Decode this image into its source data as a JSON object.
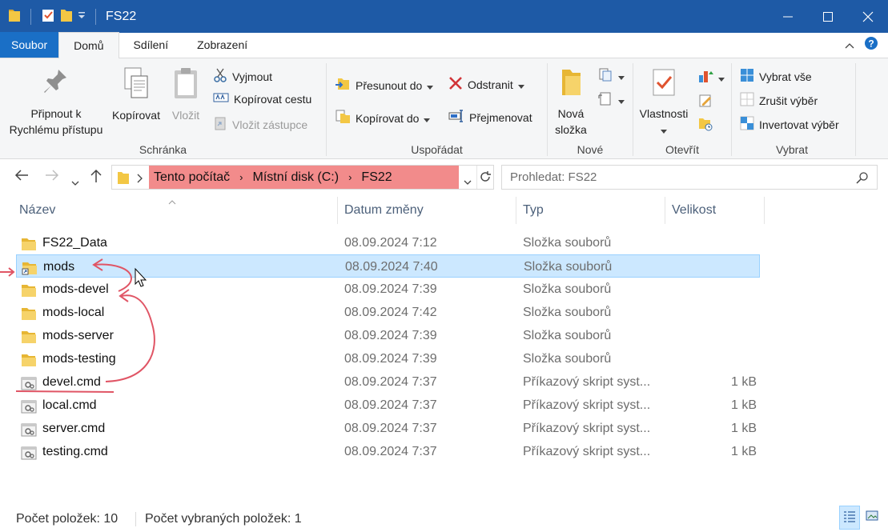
{
  "window": {
    "title": "FS22",
    "controls": [
      "minimize",
      "maximize",
      "close"
    ]
  },
  "tabs": [
    {
      "label": "Soubor"
    },
    {
      "label": "Domů"
    },
    {
      "label": "Sdílení"
    },
    {
      "label": "Zobrazení"
    }
  ],
  "ribbon": {
    "clipboard": {
      "label": "Schránka",
      "pin_line1": "Připnout k",
      "pin_line2": "Rychlému přístupu",
      "copy": "Kopírovat",
      "paste": "Vložit",
      "cut": "Vyjmout",
      "copy_path": "Kopírovat cestu",
      "paste_shortcut": "Vložit zástupce"
    },
    "organize": {
      "label": "Uspořádat",
      "move_to": "Přesunout do",
      "copy_to": "Kopírovat do",
      "delete": "Odstranit",
      "rename": "Přejmenovat"
    },
    "new": {
      "label": "Nové",
      "new_folder_line1": "Nová",
      "new_folder_line2": "složka"
    },
    "open": {
      "label": "Otevřít",
      "properties": "Vlastnosti"
    },
    "select": {
      "label": "Vybrat",
      "select_all": "Vybrat vše",
      "select_none": "Zrušit výběr",
      "invert": "Invertovat výběr"
    }
  },
  "address": {
    "crumbs": [
      "Tento počítač",
      "Místní disk (C:)",
      "FS22"
    ],
    "search_placeholder": "Prohledat: FS22"
  },
  "columns": {
    "name": "Název",
    "date": "Datum změny",
    "type": "Typ",
    "size": "Velikost"
  },
  "files": [
    {
      "name": "FS22_Data",
      "date": "08.09.2024 7:12",
      "type": "Složka souborů",
      "size": "",
      "kind": "folder"
    },
    {
      "name": "mods",
      "date": "08.09.2024 7:40",
      "type": "Složka souborů",
      "size": "",
      "kind": "folder-link",
      "selected": true
    },
    {
      "name": "mods-devel",
      "date": "08.09.2024 7:39",
      "type": "Složka souborů",
      "size": "",
      "kind": "folder"
    },
    {
      "name": "mods-local",
      "date": "08.09.2024 7:42",
      "type": "Složka souborů",
      "size": "",
      "kind": "folder"
    },
    {
      "name": "mods-server",
      "date": "08.09.2024 7:39",
      "type": "Složka souborů",
      "size": "",
      "kind": "folder"
    },
    {
      "name": "mods-testing",
      "date": "08.09.2024 7:39",
      "type": "Složka souborů",
      "size": "",
      "kind": "folder"
    },
    {
      "name": "devel.cmd",
      "date": "08.09.2024 7:37",
      "type": "Příkazový skript syst...",
      "size": "1 kB",
      "kind": "cmd"
    },
    {
      "name": "local.cmd",
      "date": "08.09.2024 7:37",
      "type": "Příkazový skript syst...",
      "size": "1 kB",
      "kind": "cmd"
    },
    {
      "name": "server.cmd",
      "date": "08.09.2024 7:37",
      "type": "Příkazový skript syst...",
      "size": "1 kB",
      "kind": "cmd"
    },
    {
      "name": "testing.cmd",
      "date": "08.09.2024 7:37",
      "type": "Příkazový skript syst...",
      "size": "1 kB",
      "kind": "cmd"
    }
  ],
  "status": {
    "count": "Počet položek: 10",
    "selected": "Počet vybraných položek: 1"
  },
  "colors": {
    "titlebar": "#1e5aa6",
    "file_tab": "#1a6fc6",
    "breadcrumb_highlight": "#f28b8b",
    "selection": "#cce8ff",
    "annotation": "#e05565"
  }
}
